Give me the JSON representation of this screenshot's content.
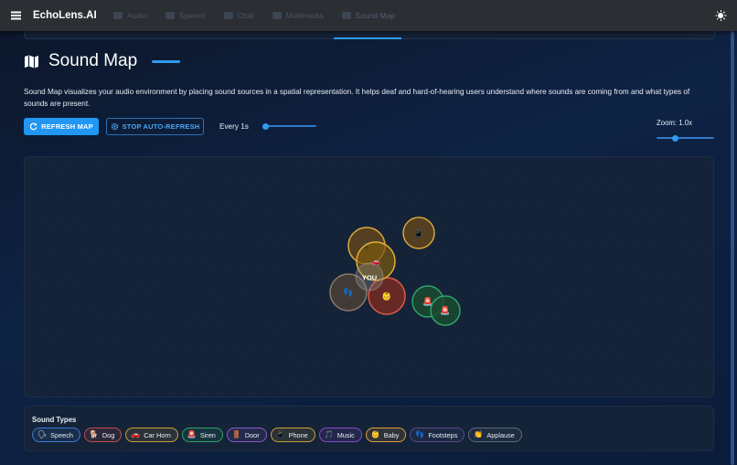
{
  "app": {
    "brand": "EchoLens.AI",
    "tabs": [
      {
        "label": "Audio",
        "icon": "audio-icon"
      },
      {
        "label": "Speech",
        "icon": "speech-icon"
      },
      {
        "label": "Chat",
        "icon": "chat-icon"
      },
      {
        "label": "Multimedia",
        "icon": "multimedia-icon"
      },
      {
        "label": "Sound Map",
        "icon": "map-icon",
        "active": true
      }
    ]
  },
  "page": {
    "title": "Sound Map",
    "description": "Sound Map visualizes your audio environment by placing sound sources in a spatial representation. It helps deaf and hard-of-hearing users understand where sounds are coming from and what types of sounds are present."
  },
  "controls": {
    "refresh_label": "REFRESH MAP",
    "stop_label": "STOP AUTO-REFRESH",
    "interval_label": "Every 1s",
    "interval_slider_fraction": 0.05,
    "zoom_label": "Zoom: 1.0x",
    "zoom_slider_fraction": 0.33
  },
  "map": {
    "center_label": "YOU",
    "sources": [
      {
        "type": "Phone",
        "emoji": "📱",
        "color": "#d9a63a"
      },
      {
        "type": "Phone",
        "emoji": "📱",
        "color": "#d9a63a"
      },
      {
        "type": "Car Horn",
        "emoji": "🚗",
        "color": "#e3b030"
      },
      {
        "type": "Footsteps",
        "emoji": "👣",
        "color": "#8a7a68"
      },
      {
        "type": "Baby",
        "emoji": "👶",
        "color": "#e05a4a"
      },
      {
        "type": "Siren",
        "emoji": "🚨",
        "color": "#2fa36a"
      },
      {
        "type": "Siren",
        "emoji": "🚨",
        "color": "#2fa36a"
      }
    ]
  },
  "legend": {
    "title": "Sound Types",
    "items": [
      {
        "label": "Speech",
        "emoji": "🗣",
        "color": "#3a7bd5"
      },
      {
        "label": "Dog",
        "emoji": "🐕",
        "color": "#c94a4a"
      },
      {
        "label": "Car Horn",
        "emoji": "🚗",
        "color": "#c9a03a"
      },
      {
        "label": "Siren",
        "emoji": "🚨",
        "color": "#2fa36a"
      },
      {
        "label": "Door",
        "emoji": "🚪",
        "color": "#8a5ac9"
      },
      {
        "label": "Phone",
        "emoji": "📱",
        "color": "#c9a03a"
      },
      {
        "label": "Music",
        "emoji": "🎵",
        "color": "#8a4ac9"
      },
      {
        "label": "Baby",
        "emoji": "👶",
        "color": "#e0a03a"
      },
      {
        "label": "Footsteps",
        "emoji": "👣",
        "color": "#5a4a8a"
      },
      {
        "label": "Applause",
        "emoji": "👏",
        "color": "#5a6a7a"
      }
    ]
  }
}
